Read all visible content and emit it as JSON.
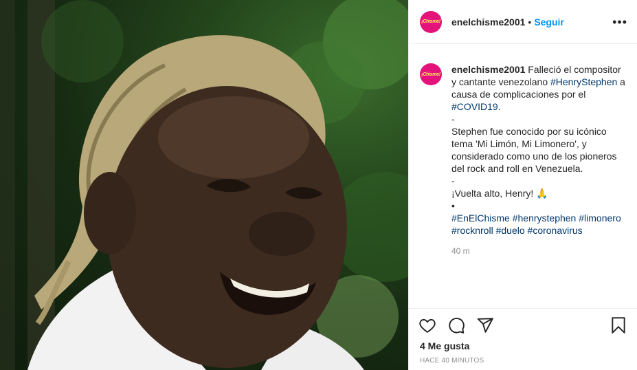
{
  "header": {
    "username": "enelchisme2001",
    "separator": "•",
    "follow_label": "Seguir",
    "more_icon": "more-horizontal-icon",
    "avatar_text": "¡Chisme!"
  },
  "caption": {
    "username": "enelchisme2001",
    "text_1": " Falleció el compositor y cantante venezolano ",
    "tag_1": "#HenryStephen",
    "text_2": " a causa de complicaciones por el ",
    "tag_2": "#COVID19",
    "text_3": ".\n-\nStephen fue conocido por su icónico tema 'Mi Limón, Mi Limonero', y considerado como uno de los pioneros del rock and roll en Venezuela.\n-\n¡Vuelta alto, Henry! 🙏\n•",
    "hashtags": [
      "#EnElChisme",
      "#henrystephen",
      "#limonero",
      "#rocknroll",
      "#duelo",
      "#coronavirus"
    ],
    "relative_time": "40 m"
  },
  "actions": {
    "like_icon": "heart-icon",
    "comment_icon": "comment-icon",
    "share_icon": "send-icon",
    "save_icon": "bookmark-icon"
  },
  "likes_label": "4 Me gusta",
  "timestamp": "HACE 40 MINUTOS",
  "colors": {
    "follow": "#0095f6",
    "hashtag": "#00376b",
    "avatar_bg": "#e4137c",
    "muted": "#8e8e8e"
  }
}
